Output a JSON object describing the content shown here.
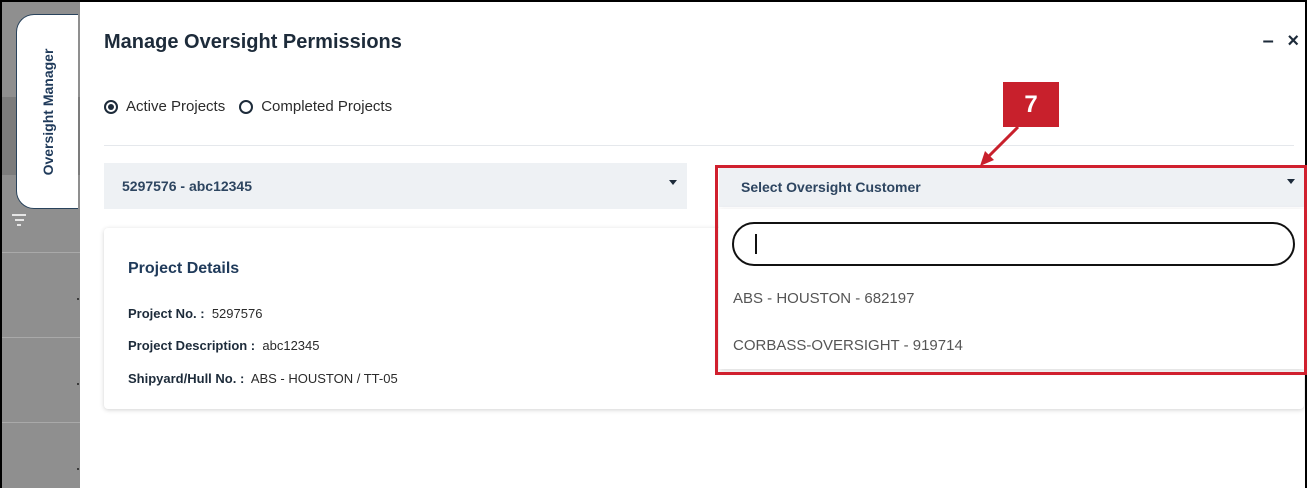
{
  "sidebar": {
    "vertical_tab_label": "Oversight Manager"
  },
  "dialog": {
    "title": "Manage Oversight Permissions",
    "minimize_label": "–",
    "close_label": "×"
  },
  "project_filter": {
    "options": [
      {
        "label": "Active Projects",
        "selected": true
      },
      {
        "label": "Completed Projects",
        "selected": false
      }
    ]
  },
  "project_select": {
    "value": "5297576 - abc12345"
  },
  "customer_select": {
    "placeholder": "Select Oversight Customer",
    "search_value": "",
    "options": [
      "ABS - HOUSTON - 682197",
      "CORBASS-OVERSIGHT - 919714"
    ]
  },
  "project_details": {
    "title": "Project Details",
    "rows": [
      {
        "label": "Project No. :",
        "value": "5297576"
      },
      {
        "label": "Project Description :",
        "value": "abc12345"
      },
      {
        "label": "Shipyard/Hull No. :",
        "value": "ABS - HOUSTON / TT-05"
      }
    ]
  },
  "annotation": {
    "step_number": "7",
    "color": "#c8202c"
  }
}
